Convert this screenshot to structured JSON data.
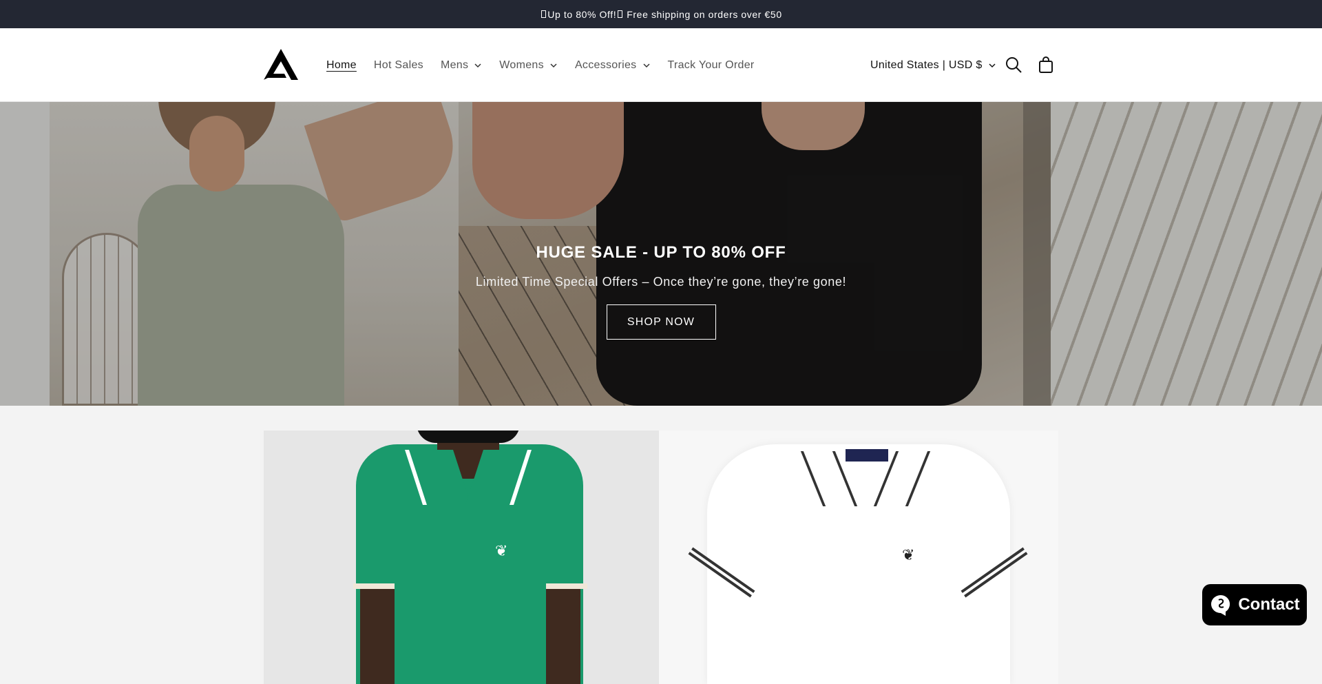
{
  "announcement": {
    "text_before": "Up to 80% Off!",
    "text_after": "Free shipping on orders over €50"
  },
  "header": {
    "logo_icon": "brand-logo-icon",
    "nav": [
      {
        "label": "Home",
        "active": true,
        "dropdown": false
      },
      {
        "label": "Hot Sales",
        "active": false,
        "dropdown": false
      },
      {
        "label": "Mens",
        "active": false,
        "dropdown": true
      },
      {
        "label": "Womens",
        "active": false,
        "dropdown": true
      },
      {
        "label": "Accessories",
        "active": false,
        "dropdown": true
      },
      {
        "label": "Track Your Order",
        "active": false,
        "dropdown": false
      }
    ],
    "region_label": "United States | USD $",
    "search_icon": "search-icon",
    "cart_icon": "cart-icon"
  },
  "hero": {
    "title": "HUGE SALE - UP TO 80% OFF",
    "subtitle": "Limited Time Special Offers – Once they’re gone, they’re gone!",
    "button_label": "SHOP NOW"
  },
  "products": [
    {
      "image": "green-polo-shirt-on-model"
    },
    {
      "image": "white-polo-shirt-flat"
    }
  ],
  "contact": {
    "label": "Contact",
    "icon": "chat-icon"
  },
  "colors": {
    "announcement_bg": "#232733",
    "page_bg": "#f3f3f3",
    "contact_bg": "#000000"
  }
}
